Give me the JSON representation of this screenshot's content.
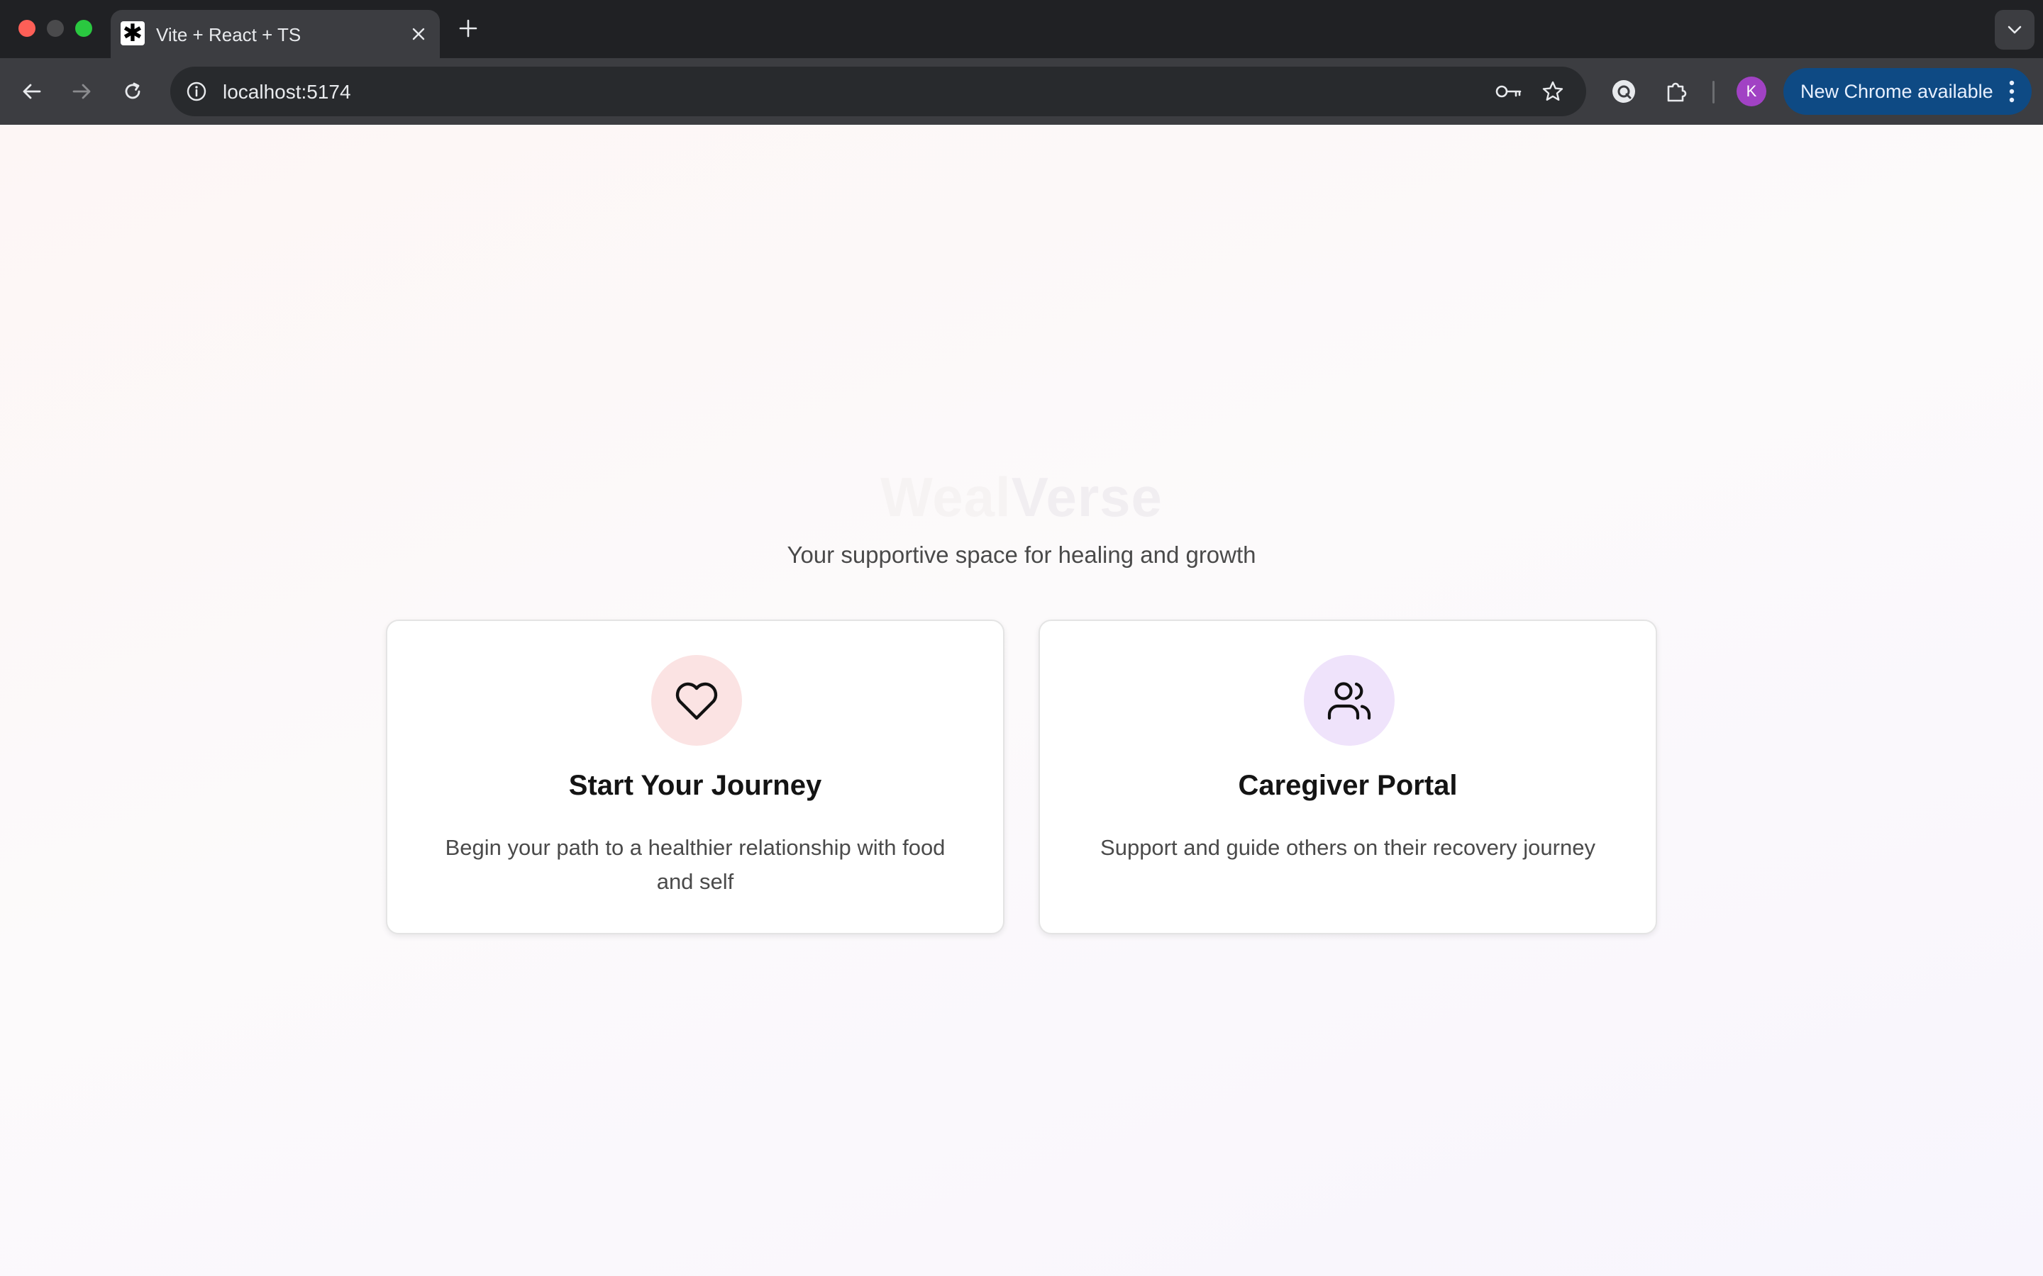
{
  "browser": {
    "tab": {
      "title": "Vite + React + TS",
      "favicon": "asterisk-favicon"
    },
    "address_bar": {
      "url": "localhost:5174"
    },
    "profile_initial": "K",
    "update_label": "New Chrome available",
    "colors": {
      "avatar": "#a142c4",
      "update_chip": "#0e4a84"
    }
  },
  "page": {
    "title_faded_part1": "Weal",
    "title_faded_part2": "Verse",
    "subtitle": "Your supportive space for healing and growth",
    "cards": [
      {
        "icon": "heart-icon",
        "title": "Start Your Journey",
        "description": "Begin your path to a healthier relationship with food and self",
        "accent": "#fbe3e3"
      },
      {
        "icon": "users-icon",
        "title": "Caregiver Portal",
        "description": "Support and guide others on their recovery journey",
        "accent": "#efe3fb"
      }
    ]
  }
}
